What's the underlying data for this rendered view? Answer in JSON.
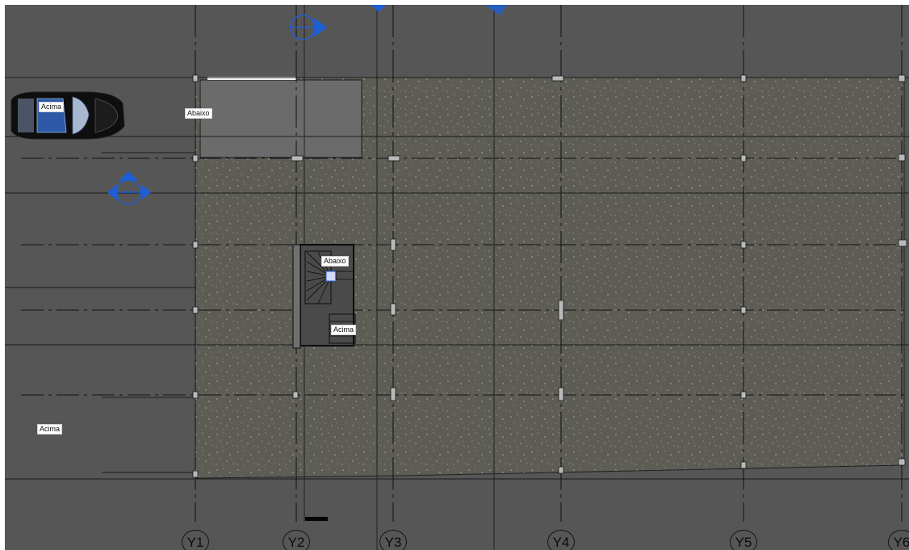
{
  "view": {
    "background_color": "#565656",
    "slab_color": "#5d5c55",
    "line_color": "#1a1a1a",
    "marker_color": "#1e5fd6"
  },
  "grid_labels": [
    "Y1",
    "Y2",
    "Y3",
    "Y4",
    "Y5",
    "Y6"
  ],
  "tags": {
    "car_up": "Acima",
    "ramp_down": "Abaixo",
    "stair_down": "Abaixo",
    "stair_up": "Acima",
    "zone_up": "Acima"
  },
  "icons": {
    "car": "car-icon",
    "section_marker": "section-marker-icon",
    "stair": "stair-icon"
  }
}
